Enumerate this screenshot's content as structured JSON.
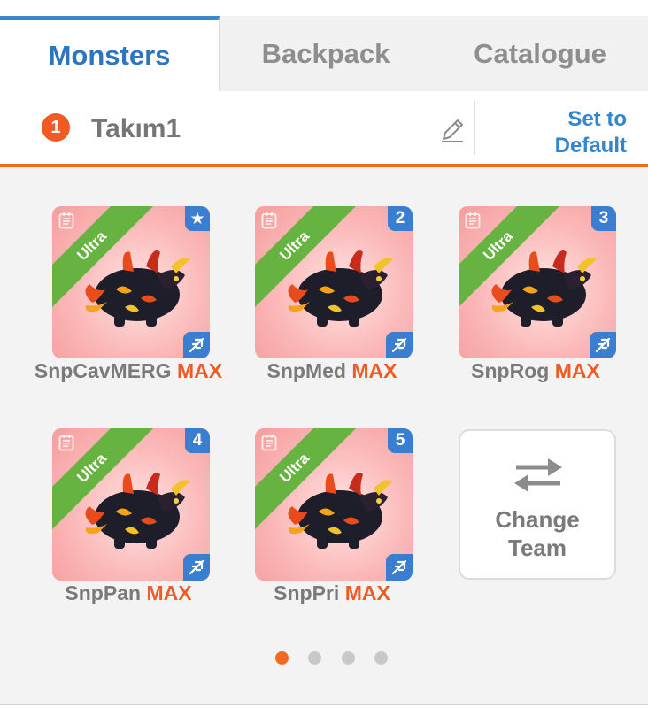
{
  "tabs": [
    {
      "label": "Monsters",
      "active": true
    },
    {
      "label": "Backpack",
      "active": false
    },
    {
      "label": "Catalogue",
      "active": false
    }
  ],
  "team": {
    "number": "1",
    "name": "Takım1",
    "set_default_line1": "Set to",
    "set_default_line2": "Default"
  },
  "monsters": [
    {
      "name": "SnpCavMERG",
      "level": "MAX",
      "rarity": "Ultra",
      "slot": "★"
    },
    {
      "name": "SnpMed",
      "level": "MAX",
      "rarity": "Ultra",
      "slot": "2"
    },
    {
      "name": "SnpRog",
      "level": "MAX",
      "rarity": "Ultra",
      "slot": "3"
    },
    {
      "name": "SnpPan",
      "level": "MAX",
      "rarity": "Ultra",
      "slot": "4"
    },
    {
      "name": "SnpPri",
      "level": "MAX",
      "rarity": "Ultra",
      "slot": "5"
    }
  ],
  "change_team": {
    "line1": "Change",
    "line2": "Team"
  },
  "pagination": {
    "pages": 4,
    "current": 1
  },
  "colors": {
    "accent": "#f26a21",
    "tab_active": "#2c75c0",
    "rarity_ultra": "#67b341",
    "badge_blue": "#3a7ed1"
  },
  "icons": {
    "edit": "pencil-icon",
    "swap": "swap-arrows-icon",
    "element": "flying-element-icon",
    "note": "notes-icon",
    "favorite": "star-icon"
  }
}
